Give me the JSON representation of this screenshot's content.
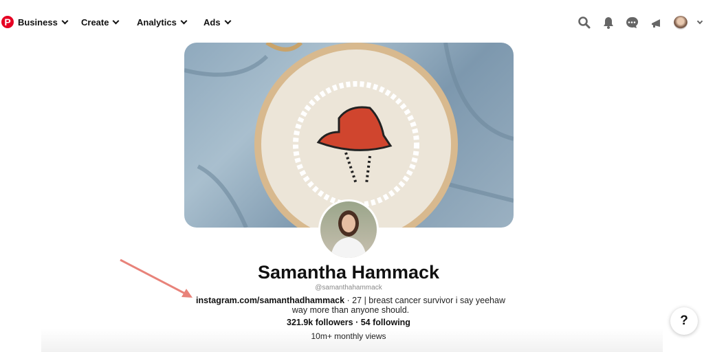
{
  "nav": {
    "logo": "P",
    "items": [
      {
        "label": "Business"
      },
      {
        "label": "Create"
      },
      {
        "label": "Analytics"
      },
      {
        "label": "Ads"
      }
    ],
    "icons": [
      "search-icon",
      "bell-icon",
      "messages-icon",
      "megaphone-icon",
      "avatar",
      "chevron-down-icon"
    ]
  },
  "profile": {
    "name": "Samantha Hammack",
    "handle": "@samanthahammack",
    "website": "instagram.com/samanthadhammack",
    "bio": " · 27 | breast cancer survivor i say yeehaw way more than anyone should.",
    "stats": "321.9k followers · 54 following",
    "views": "10m+ monthly views"
  },
  "help": "?",
  "colors": {
    "brand": "#e60023",
    "arrow": "#e8837a"
  }
}
